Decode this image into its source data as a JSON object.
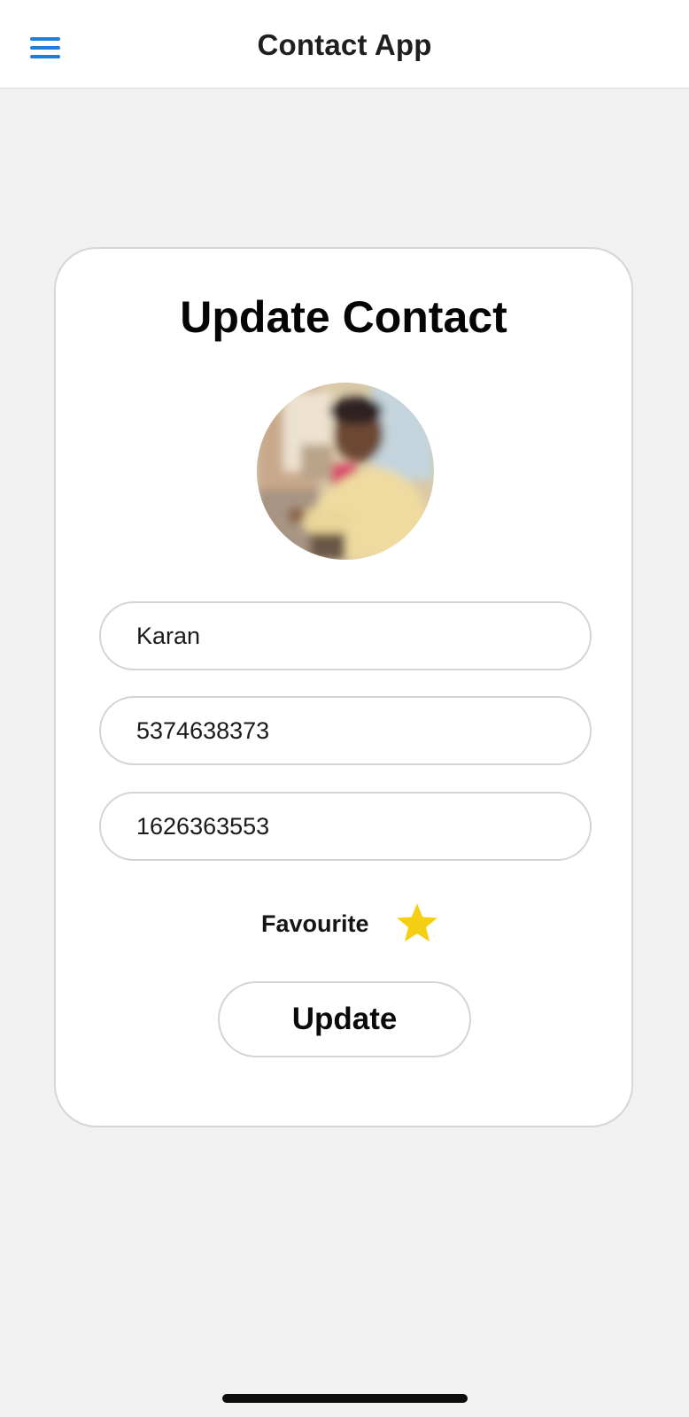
{
  "header": {
    "title": "Contact App",
    "menu_icon": "hamburger-menu-icon",
    "accent_color": "#1e7fd6"
  },
  "card": {
    "title": "Update Contact",
    "avatar_alt": "contact-photo"
  },
  "form": {
    "name_value": "Karan",
    "phone_value": "5374638373",
    "alt_phone_value": "1626363553"
  },
  "favourite": {
    "label": "Favourite",
    "icon": "star-icon",
    "is_favourite": true,
    "star_color": "#f5cf14"
  },
  "actions": {
    "update_label": "Update"
  }
}
